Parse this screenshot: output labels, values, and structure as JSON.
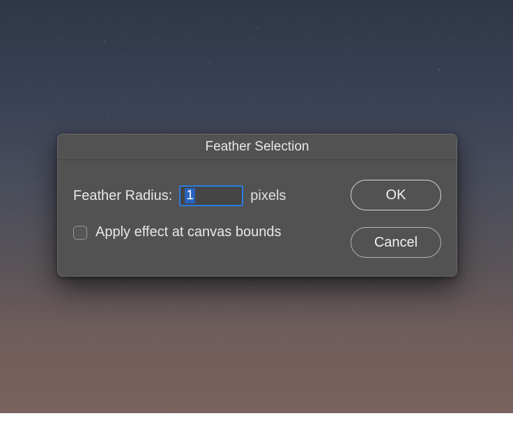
{
  "dialog": {
    "title": "Feather Selection",
    "radius_label": "Feather Radius:",
    "radius_value": "1",
    "radius_unit": "pixels",
    "apply_label": "Apply effect at canvas bounds",
    "apply_checked": false,
    "ok_label": "OK",
    "cancel_label": "Cancel"
  }
}
